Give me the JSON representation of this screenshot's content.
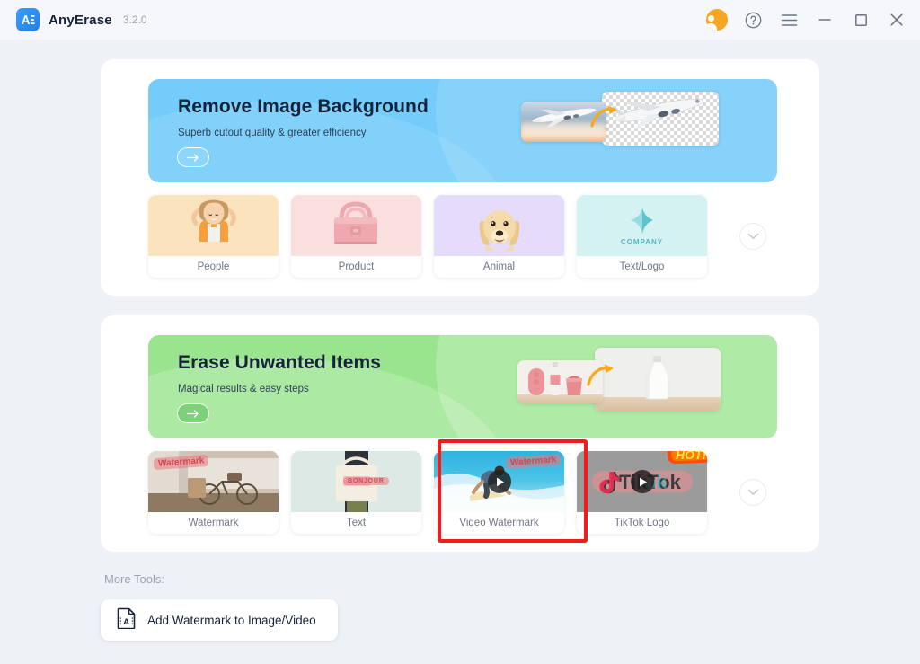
{
  "window": {
    "app_name": "AnyErase",
    "version": "3.2.0",
    "logo_text": "AE",
    "controls": {
      "account": "account-avatar",
      "help": "?",
      "menu": "hamburger-menu",
      "minimize": "minimize",
      "maximize": "maximize",
      "close": "close"
    }
  },
  "sections": [
    {
      "id": "remove-image-background",
      "banner": {
        "title": "Remove Image Background",
        "subtitle": "Superb cutout quality & greater efficiency",
        "cta": "arrow-right-icon",
        "accent": "#74ccfa"
      },
      "cards": [
        {
          "label": "People",
          "thumb": "girl-photo",
          "bg": "#fbe3bd"
        },
        {
          "label": "Product",
          "thumb": "pink-handbag-photo",
          "bg": "#fadfdf"
        },
        {
          "label": "Animal",
          "thumb": "golden-retriever-photo",
          "bg": "#e4dcfa"
        },
        {
          "label": "Text/Logo",
          "thumb": "company-logo-mark",
          "bg": "#d5f2f3",
          "logo_caption": "COMPANY"
        }
      ],
      "expand": "chevron-down-icon"
    },
    {
      "id": "erase-unwanted-items",
      "banner": {
        "title": "Erase Unwanted Items",
        "subtitle": "Magical results & easy steps",
        "cta": "arrow-right-icon",
        "accent": "#9ae48f"
      },
      "cards": [
        {
          "label": "Watermark",
          "thumb": "bicycle-photo",
          "overlay_text": "Watermark",
          "bg": "#b9a08a"
        },
        {
          "label": "Text",
          "thumb": "tote-bag-photo",
          "overlay_text": "BONJOUR",
          "bg": "#dde9e4"
        },
        {
          "label": "Video Watermark",
          "thumb": "surfer-video",
          "overlay_text": "Watermark",
          "bg": "#49c3e8",
          "selected": true,
          "has_play": true
        },
        {
          "label": "TikTok Logo",
          "thumb": "tiktok-video",
          "overlay_text": "TikTok",
          "bg": "#9b9b9b",
          "badge": "HOT!",
          "has_play": true
        }
      ],
      "expand": "chevron-down-icon"
    }
  ],
  "more_tools": {
    "label": "More Tools:",
    "items": [
      {
        "label": "Add Watermark to Image/Video",
        "icon": "document-text-icon"
      }
    ]
  },
  "colors": {
    "page_bg": "#eef1f6",
    "panel_bg": "#ffffff",
    "selection": "#f51b1b",
    "accent_blue": "#74ccfa",
    "accent_green": "#9ae48f",
    "badge_orange": "#f7941e"
  }
}
